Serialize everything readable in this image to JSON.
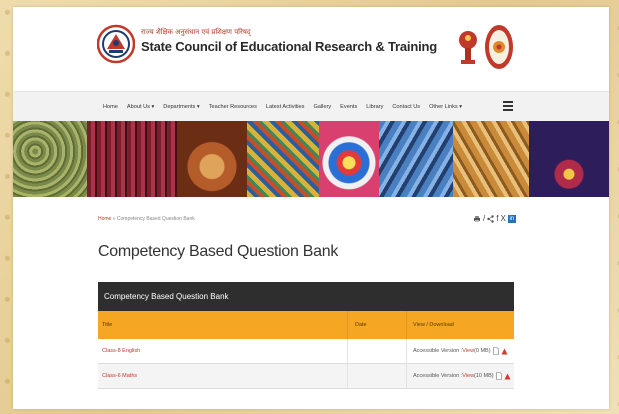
{
  "header": {
    "hindi_title": "राज्य शैक्षिक अनुसंधान एवं प्रशिक्षण परिषद्",
    "title": "State Council of Educational Research & Training"
  },
  "nav": {
    "items": [
      "Home",
      "About Us ▾",
      "Departments ▾",
      "Teacher Resources",
      "Latest Activities",
      "Gallery",
      "Events",
      "Library",
      "Contact Us",
      "Other Links ▾"
    ]
  },
  "breadcrumb": {
    "home": "Home",
    "separator": " » ",
    "current": "Competency Based Question Bank"
  },
  "share": {
    "icons": [
      "print-icon",
      "share-icon",
      "facebook-icon",
      "x-icon",
      "linkedin-icon"
    ],
    "sep": "/",
    "f": "f",
    "x": "X",
    "in": "in"
  },
  "page_title": "Competency Based Question Bank",
  "table": {
    "caption": "Competency Based Question Bank",
    "headers": {
      "title": "Title",
      "date": "Date",
      "view": "View / Download"
    },
    "rows": [
      {
        "title": "Class-8 English",
        "date": "",
        "prefix": "Accessible Version : ",
        "link": "View",
        "size": " (0 MB)"
      },
      {
        "title": "Class-6 Maths",
        "date": "",
        "prefix": "Accessible Version : ",
        "link": "View",
        "size": " (10 MB)"
      }
    ]
  },
  "colors": {
    "accent": "#f5a623",
    "caption_bg": "#2e2e2e",
    "link": "#c0392b"
  }
}
